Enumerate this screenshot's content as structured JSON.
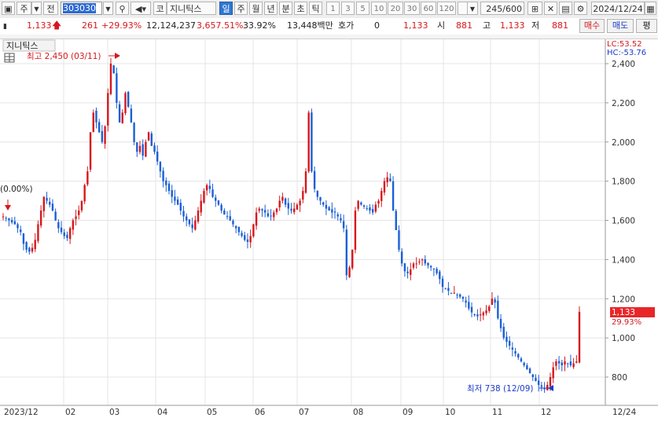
{
  "toolbar": {
    "market_label": "주",
    "prev_label": "전",
    "code_value": "303030",
    "market2_label": "코",
    "name_value": "지니틱스",
    "period_tabs": [
      "일",
      "주",
      "월",
      "년",
      "분",
      "초",
      "틱"
    ],
    "selected_period": "일",
    "interval_buttons": [
      "1",
      "3",
      "5",
      "10",
      "20",
      "30",
      "60",
      "120"
    ],
    "count_value": "245",
    "count_total": "/600",
    "date_value": "2024/12/24"
  },
  "quote": {
    "price": "1,133",
    "change": "261",
    "change_rate": "+29.93%",
    "volume": "12,124,237",
    "volume_rate": "3,657.51%",
    "turnover": "33.92%",
    "amount": "13,448백만",
    "hoga_label": "호가",
    "hoga_value": "0",
    "hoga_price": "1,133",
    "open_label": "시",
    "open": "881",
    "high_label": "고",
    "high": "1,133",
    "low_label": "저",
    "low": "881",
    "buy_label": "매수",
    "sell_label": "매도",
    "eval_label": "평"
  },
  "chart_data": {
    "type": "candlestick",
    "title": "지니틱스",
    "ylim": [
      700,
      2450
    ],
    "y_ticks": [
      "2,400",
      "2,200",
      "2,000",
      "1,800",
      "1,600",
      "1,400",
      "1,200",
      "1,000",
      "800"
    ],
    "x_labels": [
      "2023/12",
      "02",
      "03",
      "04",
      "05",
      "06",
      "07",
      "08",
      "09",
      "10",
      "11",
      "12",
      "12/24"
    ],
    "legend_lc": "LC:53.52",
    "legend_hc": "HC:-53.76",
    "current_price_label": "1,133",
    "current_change_label": "29.93%",
    "high_annotation": "최고 2,450 (03/11)",
    "low_annotation": "최저 738 (12/09)",
    "start_annotation": "(0.00%)",
    "approx_close_series": [
      1620,
      1610,
      1600,
      1590,
      1580,
      1560,
      1540,
      1480,
      1450,
      1440,
      1460,
      1500,
      1580,
      1650,
      1720,
      1700,
      1680,
      1650,
      1600,
      1560,
      1540,
      1520,
      1510,
      1560,
      1600,
      1620,
      1650,
      1700,
      1780,
      1850,
      2050,
      2150,
      2100,
      2050,
      2000,
      2080,
      2250,
      2400,
      2350,
      2200,
      2100,
      2150,
      2250,
      2180,
      2100,
      2000,
      1950,
      1980,
      1930,
      2000,
      2050,
      1980,
      1950,
      1900,
      1850,
      1800,
      1780,
      1750,
      1720,
      1700,
      1680,
      1650,
      1620,
      1600,
      1580,
      1560,
      1600,
      1650,
      1700,
      1750,
      1780,
      1760,
      1720,
      1700,
      1680,
      1650,
      1630,
      1620,
      1600,
      1580,
      1560,
      1540,
      1520,
      1500,
      1490,
      1520,
      1580,
      1640,
      1660,
      1650,
      1640,
      1620,
      1620,
      1640,
      1660,
      1700,
      1720,
      1680,
      1660,
      1650,
      1660,
      1680,
      1700,
      1750,
      1850,
      2150,
      1850,
      1760,
      1720,
      1700,
      1680,
      1660,
      1650,
      1640,
      1640,
      1620,
      1600,
      1560,
      1320,
      1360,
      1450,
      1650,
      1700,
      1680,
      1670,
      1660,
      1650,
      1640,
      1680,
      1700,
      1750,
      1800,
      1820,
      1800,
      1650,
      1550,
      1450,
      1380,
      1340,
      1330,
      1350,
      1380,
      1380,
      1390,
      1400,
      1380,
      1370,
      1360,
      1350,
      1330,
      1300,
      1260,
      1250,
      1240,
      1230,
      1230,
      1220,
      1210,
      1200,
      1180,
      1150,
      1130,
      1120,
      1110,
      1120,
      1130,
      1140,
      1160,
      1200,
      1180,
      1100,
      1050,
      1000,
      980,
      960,
      940,
      920,
      900,
      880,
      860,
      840,
      820,
      800,
      780,
      760,
      750,
      738,
      760,
      800,
      850,
      880,
      870,
      860,
      880,
      870,
      860,
      870,
      880,
      1133
    ]
  }
}
